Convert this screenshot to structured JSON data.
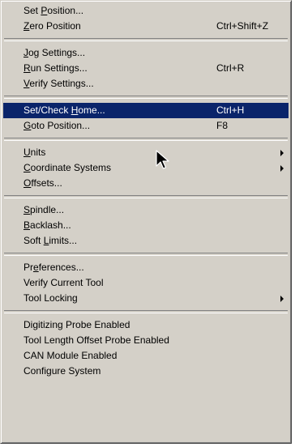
{
  "menu": {
    "items": [
      {
        "label": "Set Position...",
        "mn": "P",
        "shortcut": ""
      },
      {
        "label": "Zero Position",
        "mn": "Z",
        "shortcut": "Ctrl+Shift+Z"
      },
      {
        "label": "Jog Settings...",
        "mn": "J",
        "shortcut": ""
      },
      {
        "label": "Run Settings...",
        "mn": "R",
        "shortcut": "Ctrl+R"
      },
      {
        "label": "Verify Settings...",
        "mn": "V",
        "shortcut": ""
      },
      {
        "label": "Set/Check Home...",
        "mn": "H",
        "shortcut": "Ctrl+H"
      },
      {
        "label": "Goto Position...",
        "mn": "G",
        "shortcut": "F8"
      },
      {
        "label": "Units",
        "mn": "U",
        "shortcut": ""
      },
      {
        "label": "Coordinate Systems",
        "mn": "C",
        "shortcut": ""
      },
      {
        "label": "Offsets...",
        "mn": "O",
        "shortcut": ""
      },
      {
        "label": "Spindle...",
        "mn": "S",
        "shortcut": ""
      },
      {
        "label": "Backlash...",
        "mn": "B",
        "shortcut": ""
      },
      {
        "label": "Soft Limits...",
        "mn": "L",
        "shortcut": ""
      },
      {
        "label": "Preferences...",
        "mn": "e",
        "shortcut": ""
      },
      {
        "label": "Verify Current Tool",
        "mn": "",
        "shortcut": ""
      },
      {
        "label": "Tool Locking",
        "mn": "",
        "shortcut": ""
      },
      {
        "label": "Digitizing Probe Enabled",
        "mn": "",
        "shortcut": ""
      },
      {
        "label": "Tool Length Offset Probe Enabled",
        "mn": "",
        "shortcut": ""
      },
      {
        "label": "CAN Module Enabled",
        "mn": "",
        "shortcut": ""
      },
      {
        "label": "Configure System",
        "mn": "",
        "shortcut": ""
      }
    ],
    "highlighted_item": "Set/Check Home...",
    "colors": {
      "menu_bg": "#d4d0c8",
      "highlight_bg": "#0a246a",
      "highlight_text": "#ffffff"
    },
    "icons": {
      "submenu": "submenu-arrow-icon",
      "cursor": "mouse-pointer-icon"
    }
  }
}
